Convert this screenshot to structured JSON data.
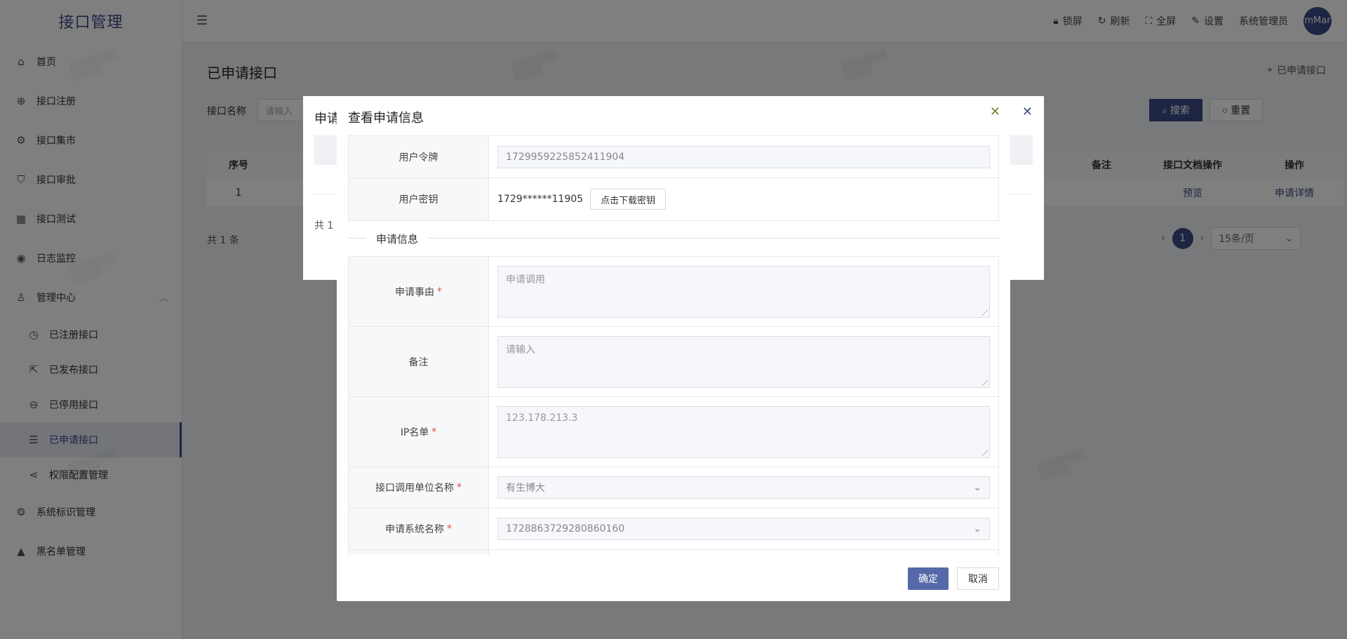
{
  "app": {
    "title": "接口管理"
  },
  "sidebar": {
    "items": [
      {
        "label": "首页",
        "icon": "home-icon"
      },
      {
        "label": "接口注册",
        "icon": "plus-circle-icon"
      },
      {
        "label": "接口集市",
        "icon": "gear-icon"
      },
      {
        "label": "接口审批",
        "icon": "shield-check-icon"
      },
      {
        "label": "接口测试",
        "icon": "grid-icon"
      },
      {
        "label": "日志监控",
        "icon": "eye-icon"
      },
      {
        "label": "管理中心",
        "icon": "user-icon"
      },
      {
        "label": "已注册接口",
        "icon": "clock-icon"
      },
      {
        "label": "已发布接口",
        "icon": "export-icon"
      },
      {
        "label": "已停用接口",
        "icon": "minus-circle-icon"
      },
      {
        "label": "已申请接口",
        "icon": "list-filter-icon"
      },
      {
        "label": "权限配置管理",
        "icon": "share-icon"
      },
      {
        "label": "系统标识管理",
        "icon": "gear-icon"
      },
      {
        "label": "黑名单管理",
        "icon": "warning-icon"
      }
    ]
  },
  "topbar": {
    "lock": "锁屏",
    "refresh": "刷新",
    "fullscreen": "全屏",
    "settings": "设置",
    "user": "系统管理员",
    "avatar": "mMar"
  },
  "page": {
    "title": "已申请接口",
    "breadcrumb": "已申请接口",
    "filter_label": "接口名称",
    "filter_placeholder": "请输入",
    "search": "搜索",
    "reset": "重置",
    "table_headers": [
      "序号",
      "备注",
      "接口文档操作",
      "操作"
    ],
    "row": {
      "index": "1",
      "preview": "预览",
      "detail": "申请详情"
    },
    "total": "共 1 条",
    "page_num": "1",
    "page_size": "15条/页"
  },
  "bg_dialog": {
    "title": "申请",
    "total": "共 1"
  },
  "modal": {
    "title": "查看申请信息",
    "token_label": "用户令牌",
    "token_value": "1729959225852411904",
    "secret_label": "用户密钥",
    "secret_value": "1729******11905",
    "download_btn": "点击下载密钥",
    "section": "申请信息",
    "reason_label": "申请事由",
    "reason_value": "申请调用",
    "remark_label": "备注",
    "remark_placeholder": "请输入",
    "ip_label": "IP名单",
    "ip_value": "123.178.213.3",
    "unit_label": "接口调用单位名称",
    "unit_value": "有生博大",
    "system_label": "申请系统名称",
    "system_value": "1728863729280860160",
    "ok": "确定",
    "cancel": "取消"
  },
  "colors": {
    "brand": "#3b4a86",
    "required": "#e94b4b",
    "ok_button": "#5569a8"
  }
}
